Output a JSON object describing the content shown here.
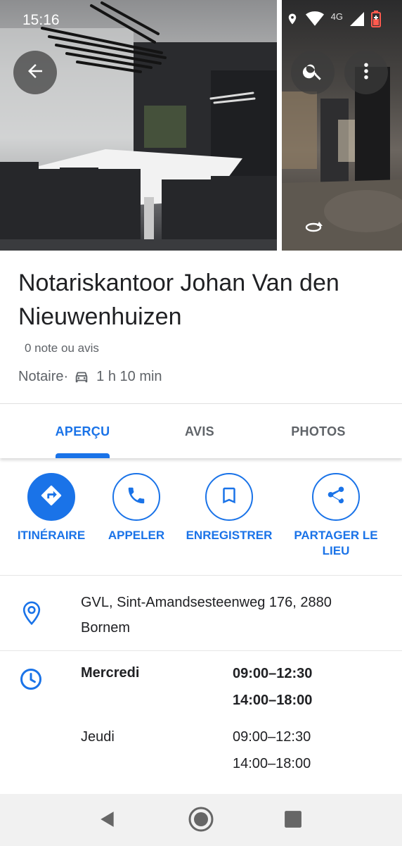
{
  "status_bar": {
    "time": "15:16",
    "network_label": "4G"
  },
  "photos": {
    "main_subject": "meeting-room-photo",
    "side_subject": "street-view-panorama"
  },
  "header_buttons": {
    "back_icon": "arrow-back-icon",
    "search_icon": "search-icon",
    "more_icon": "more-vert-icon"
  },
  "place": {
    "title": "Notariskantoor Johan Van den Nieuwenhuizen",
    "rating_text": "0 note ou avis",
    "category": "Notaire",
    "separator": " · ",
    "drive_time": "1 h 10 min"
  },
  "tabs": [
    {
      "label": "APERÇU",
      "active": true
    },
    {
      "label": "AVIS",
      "active": false
    },
    {
      "label": "PHOTOS",
      "active": false
    }
  ],
  "actions": [
    {
      "label": "ITINÉRAIRE",
      "icon": "directions-icon"
    },
    {
      "label": "APPELER",
      "icon": "phone-icon"
    },
    {
      "label": "ENREGISTRER",
      "icon": "bookmark-icon"
    },
    {
      "label": "PARTAGER LE LIEU",
      "icon": "share-icon"
    }
  ],
  "address": {
    "line1": "GVL, Sint-Amandsesteenweg 176, 2880",
    "line2": "Bornem"
  },
  "hours": [
    {
      "day": "Mercredi",
      "slots": [
        "09:00–12:30",
        "14:00–18:00"
      ],
      "today": true
    },
    {
      "day": "Jeudi",
      "slots": [
        "09:00–12:30",
        "14:00–18:00"
      ],
      "today": false
    }
  ],
  "colors": {
    "accent": "#1a73e8",
    "text_primary": "#202124",
    "text_secondary": "#5f6368"
  }
}
